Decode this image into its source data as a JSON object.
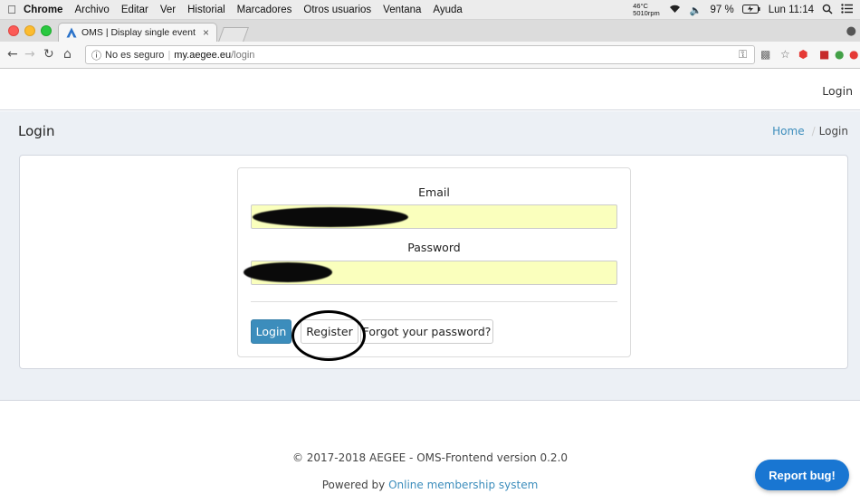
{
  "menubar": {
    "apple_icon": "apple-icon",
    "items": [
      "Chrome",
      "Archivo",
      "Editar",
      "Ver",
      "Historial",
      "Marcadores",
      "Otros usuarios",
      "Ventana",
      "Ayuda"
    ],
    "temp": "46°C",
    "rpm": "5010rpm",
    "battery": "97 %",
    "clock": "Lun 11:14"
  },
  "browser": {
    "tab_title": "OMS | Display single event",
    "tab_close": "×",
    "security_label": "No es seguro",
    "url_domain": "my.aegee.eu",
    "url_path": "/login"
  },
  "page": {
    "nav_login": "Login",
    "header_title": "Login",
    "breadcrumb_home": "Home",
    "breadcrumb_current": "Login",
    "form": {
      "email_label": "Email",
      "password_label": "Password",
      "login_button": "Login",
      "register_button": "Register",
      "forgot_button": "Forgot your password?"
    },
    "footer": {
      "copyright": "© 2017-2018 AEGEE - OMS-Frontend version 0.2.0",
      "powered_prefix": "Powered by ",
      "powered_link": "Online membership system"
    },
    "report_bug": "Report bug!"
  },
  "colors": {
    "accent": "#3c8dbc",
    "autofill": "#faffbd",
    "report_bug": "#1976d2",
    "content_bg": "#ecf0f5"
  }
}
